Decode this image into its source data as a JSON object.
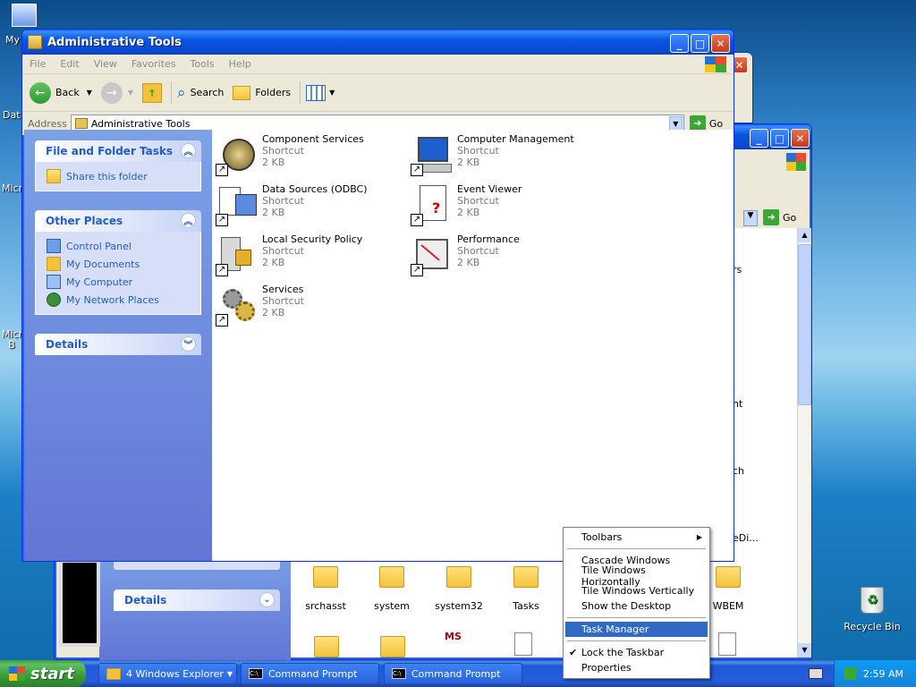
{
  "desktop": {
    "icons_left": [
      "My",
      "Dat",
      "Micro",
      "Micro B"
    ],
    "recycle_bin": "Recycle Bin"
  },
  "main_window": {
    "title": "Administrative Tools",
    "menu": [
      "File",
      "Edit",
      "View",
      "Favorites",
      "Tools",
      "Help"
    ],
    "toolbar": {
      "back": "Back",
      "search": "Search",
      "folders": "Folders"
    },
    "address_label": "Address",
    "address_value": "Administrative Tools",
    "go": "Go",
    "panels": {
      "file_tasks": {
        "title": "File and Folder Tasks",
        "items": [
          "Share this folder"
        ]
      },
      "other_places": {
        "title": "Other Places",
        "items": [
          "Control Panel",
          "My Documents",
          "My Computer",
          "My Network Places"
        ]
      },
      "details": {
        "title": "Details"
      }
    },
    "files": [
      {
        "name": "Component Services",
        "type": "Shortcut",
        "size": "2 KB"
      },
      {
        "name": "Computer Management",
        "type": "Shortcut",
        "size": "2 KB"
      },
      {
        "name": "Data Sources (ODBC)",
        "type": "Shortcut",
        "size": "2 KB"
      },
      {
        "name": "Event Viewer",
        "type": "Shortcut",
        "size": "2 KB"
      },
      {
        "name": "Local Security Policy",
        "type": "Shortcut",
        "size": "2 KB"
      },
      {
        "name": "Performance",
        "type": "Shortcut",
        "size": "2 KB"
      },
      {
        "name": "Services",
        "type": "Shortcut",
        "size": "2 KB"
      }
    ]
  },
  "back_window": {
    "go": "Go",
    "details": "Details",
    "partial_labels": [
      "rs",
      "nt",
      "ch",
      "eDi..."
    ],
    "folders": [
      "srchasst",
      "system",
      "system32",
      "Tasks",
      "WBEM"
    ]
  },
  "context_menu": {
    "items": [
      "Toolbars",
      "Cascade Windows",
      "Tile Windows Horizontally",
      "Tile Windows Vertically",
      "Show the Desktop",
      "Task Manager",
      "Lock the Taskbar",
      "Properties"
    ],
    "selected": "Task Manager",
    "checked": "Lock the Taskbar"
  },
  "taskbar": {
    "start": "start",
    "buttons": [
      "4 Windows Explorer",
      "Command Prompt",
      "Command Prompt"
    ],
    "clock": "2:59 AM"
  }
}
